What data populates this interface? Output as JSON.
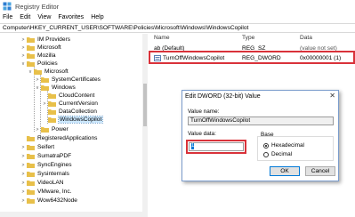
{
  "window": {
    "title": "Registry Editor"
  },
  "menu": [
    "File",
    "Edit",
    "View",
    "Favorites",
    "Help"
  ],
  "address": "Computer\\HKEY_CURRENT_USER\\SOFTWARE\\Policies\\Microsoft\\Windows\\WindowsCopilot",
  "tree": [
    {
      "label": "IM Providers",
      "exp": ">"
    },
    {
      "label": "Microsoft",
      "exp": ">"
    },
    {
      "label": "Mozilla",
      "exp": ">"
    },
    {
      "label": "Policies",
      "exp": "v"
    },
    {
      "label": "Microsoft",
      "exp": "v"
    },
    {
      "label": "SystemCertificates",
      "exp": ">"
    },
    {
      "label": "Windows",
      "exp": "v"
    },
    {
      "label": "CloudContent",
      "exp": ""
    },
    {
      "label": "CurrentVersion",
      "exp": ">"
    },
    {
      "label": "DataCollection",
      "exp": ""
    },
    {
      "label": "WindowsCopilot",
      "exp": ""
    },
    {
      "label": "Power",
      "exp": ">"
    },
    {
      "label": "RegisteredApplications",
      "exp": ""
    },
    {
      "label": "Seifert",
      "exp": ">"
    },
    {
      "label": "SumatraPDF",
      "exp": ">"
    },
    {
      "label": "SyncEngines",
      "exp": ">"
    },
    {
      "label": "Sysinternals",
      "exp": ">"
    },
    {
      "label": "VideoLAN",
      "exp": ">"
    },
    {
      "label": "VMware, Inc.",
      "exp": ">"
    },
    {
      "label": "Wow6432Node",
      "exp": ">"
    }
  ],
  "columns": {
    "name": "Name",
    "type": "Type",
    "data": "Data"
  },
  "values": [
    {
      "name": "ab (Default)",
      "type": "REG_SZ",
      "data": "(value not set)"
    },
    {
      "name": "TurnOffWindowsCopilot",
      "type": "REG_DWORD",
      "data": "0x00000001 (1)"
    }
  ],
  "dialog": {
    "title": "Edit DWORD (32-bit) Value",
    "close": "✕",
    "value_name_label": "Value name:",
    "value_name": "TurnOffWindowsCopilot",
    "value_data_label": "Value data:",
    "value_data": "1",
    "base_label": "Base",
    "hex_label": "Hexadecimal",
    "dec_label": "Decimal",
    "ok": "OK",
    "cancel": "Cancel"
  },
  "colors": {
    "highlight": "#d9323a",
    "selection": "#cce8ff",
    "folder": "#e8c04a"
  }
}
